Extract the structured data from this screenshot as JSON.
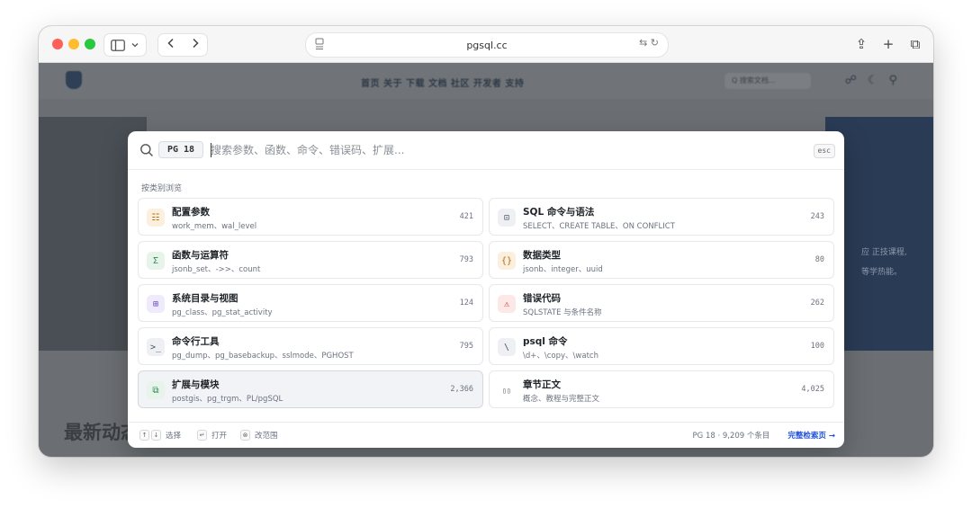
{
  "browser": {
    "url": "pgsql.cc",
    "back_icon": "chevron-left",
    "forward_icon": "chevron-right"
  },
  "background_page": {
    "nav_text": "首页 关于 下载 文档 社区 开发者 支持",
    "search_placeholder": "Q 搜索文档...",
    "hero_lines": [
      "应 正技课程,",
      "等学热能。"
    ],
    "latest_heading": "最新动态"
  },
  "palette": {
    "version_tag": "PG 18",
    "search_placeholder": "搜索参数、函数、命令、错误码、扩展...",
    "esc_label": "esc",
    "section_label": "按类别浏览",
    "categories": [
      {
        "title": "配置参数",
        "subtitle": "work_mem、wal_level",
        "count": "421",
        "icon": "sliders",
        "glyph": "☷",
        "color": "#b4690e",
        "bg": "#fbf0dd"
      },
      {
        "title": "SQL 命令与语法",
        "subtitle": "SELECT、CREATE TABLE、ON CONFLICT",
        "count": "243",
        "icon": "terminal-box",
        "glyph": "⊡",
        "color": "#4b5563",
        "bg": "#eef0f3"
      },
      {
        "title": "函数与运算符",
        "subtitle": "jsonb_set、->>、count",
        "count": "793",
        "icon": "sigma",
        "glyph": "Σ",
        "color": "#2f855a",
        "bg": "#e6f4ea"
      },
      {
        "title": "数据类型",
        "subtitle": "jsonb、integer、uuid",
        "count": "80",
        "icon": "braces",
        "glyph": "{}",
        "color": "#b4690e",
        "bg": "#fbf0dd"
      },
      {
        "title": "系统目录与视图",
        "subtitle": "pg_class、pg_stat_activity",
        "count": "124",
        "icon": "grid-table",
        "glyph": "⊞",
        "color": "#6d4fc2",
        "bg": "#efeafc"
      },
      {
        "title": "错误代码",
        "subtitle": "SQLSTATE 与条件名称",
        "count": "262",
        "icon": "warning-triangle",
        "glyph": "⚠",
        "color": "#c53030",
        "bg": "#fde8e8"
      },
      {
        "title": "命令行工具",
        "subtitle": "pg_dump、pg_basebackup、sslmode、PGHOST",
        "count": "795",
        "icon": "prompt",
        "glyph": ">_",
        "color": "#4b5563",
        "bg": "#eef0f3"
      },
      {
        "title": "psql 命令",
        "subtitle": "\\d+、\\copy、\\watch",
        "count": "100",
        "icon": "backslash",
        "glyph": "\\",
        "color": "#4b5563",
        "bg": "#eef0f3"
      },
      {
        "title": "扩展与模块",
        "subtitle": "postgis、pg_trgm、PL/pgSQL",
        "count": "2,366",
        "icon": "puzzle-blocks",
        "glyph": "⧉",
        "color": "#2f855a",
        "bg": "#e6f4ea"
      },
      {
        "title": "章节正文",
        "subtitle": "概念、教程与完整正文",
        "count": "4,025",
        "icon": "open-book",
        "glyph": "▯▯",
        "color": "#4b5563",
        "bg": "#ffffff"
      }
    ],
    "footer": {
      "select_hint": "选择",
      "open_hint": "打开",
      "scope_hint": "改范围",
      "summary": "PG 18 · 9,209 个条目",
      "full_search": "完整检索页 →"
    }
  }
}
